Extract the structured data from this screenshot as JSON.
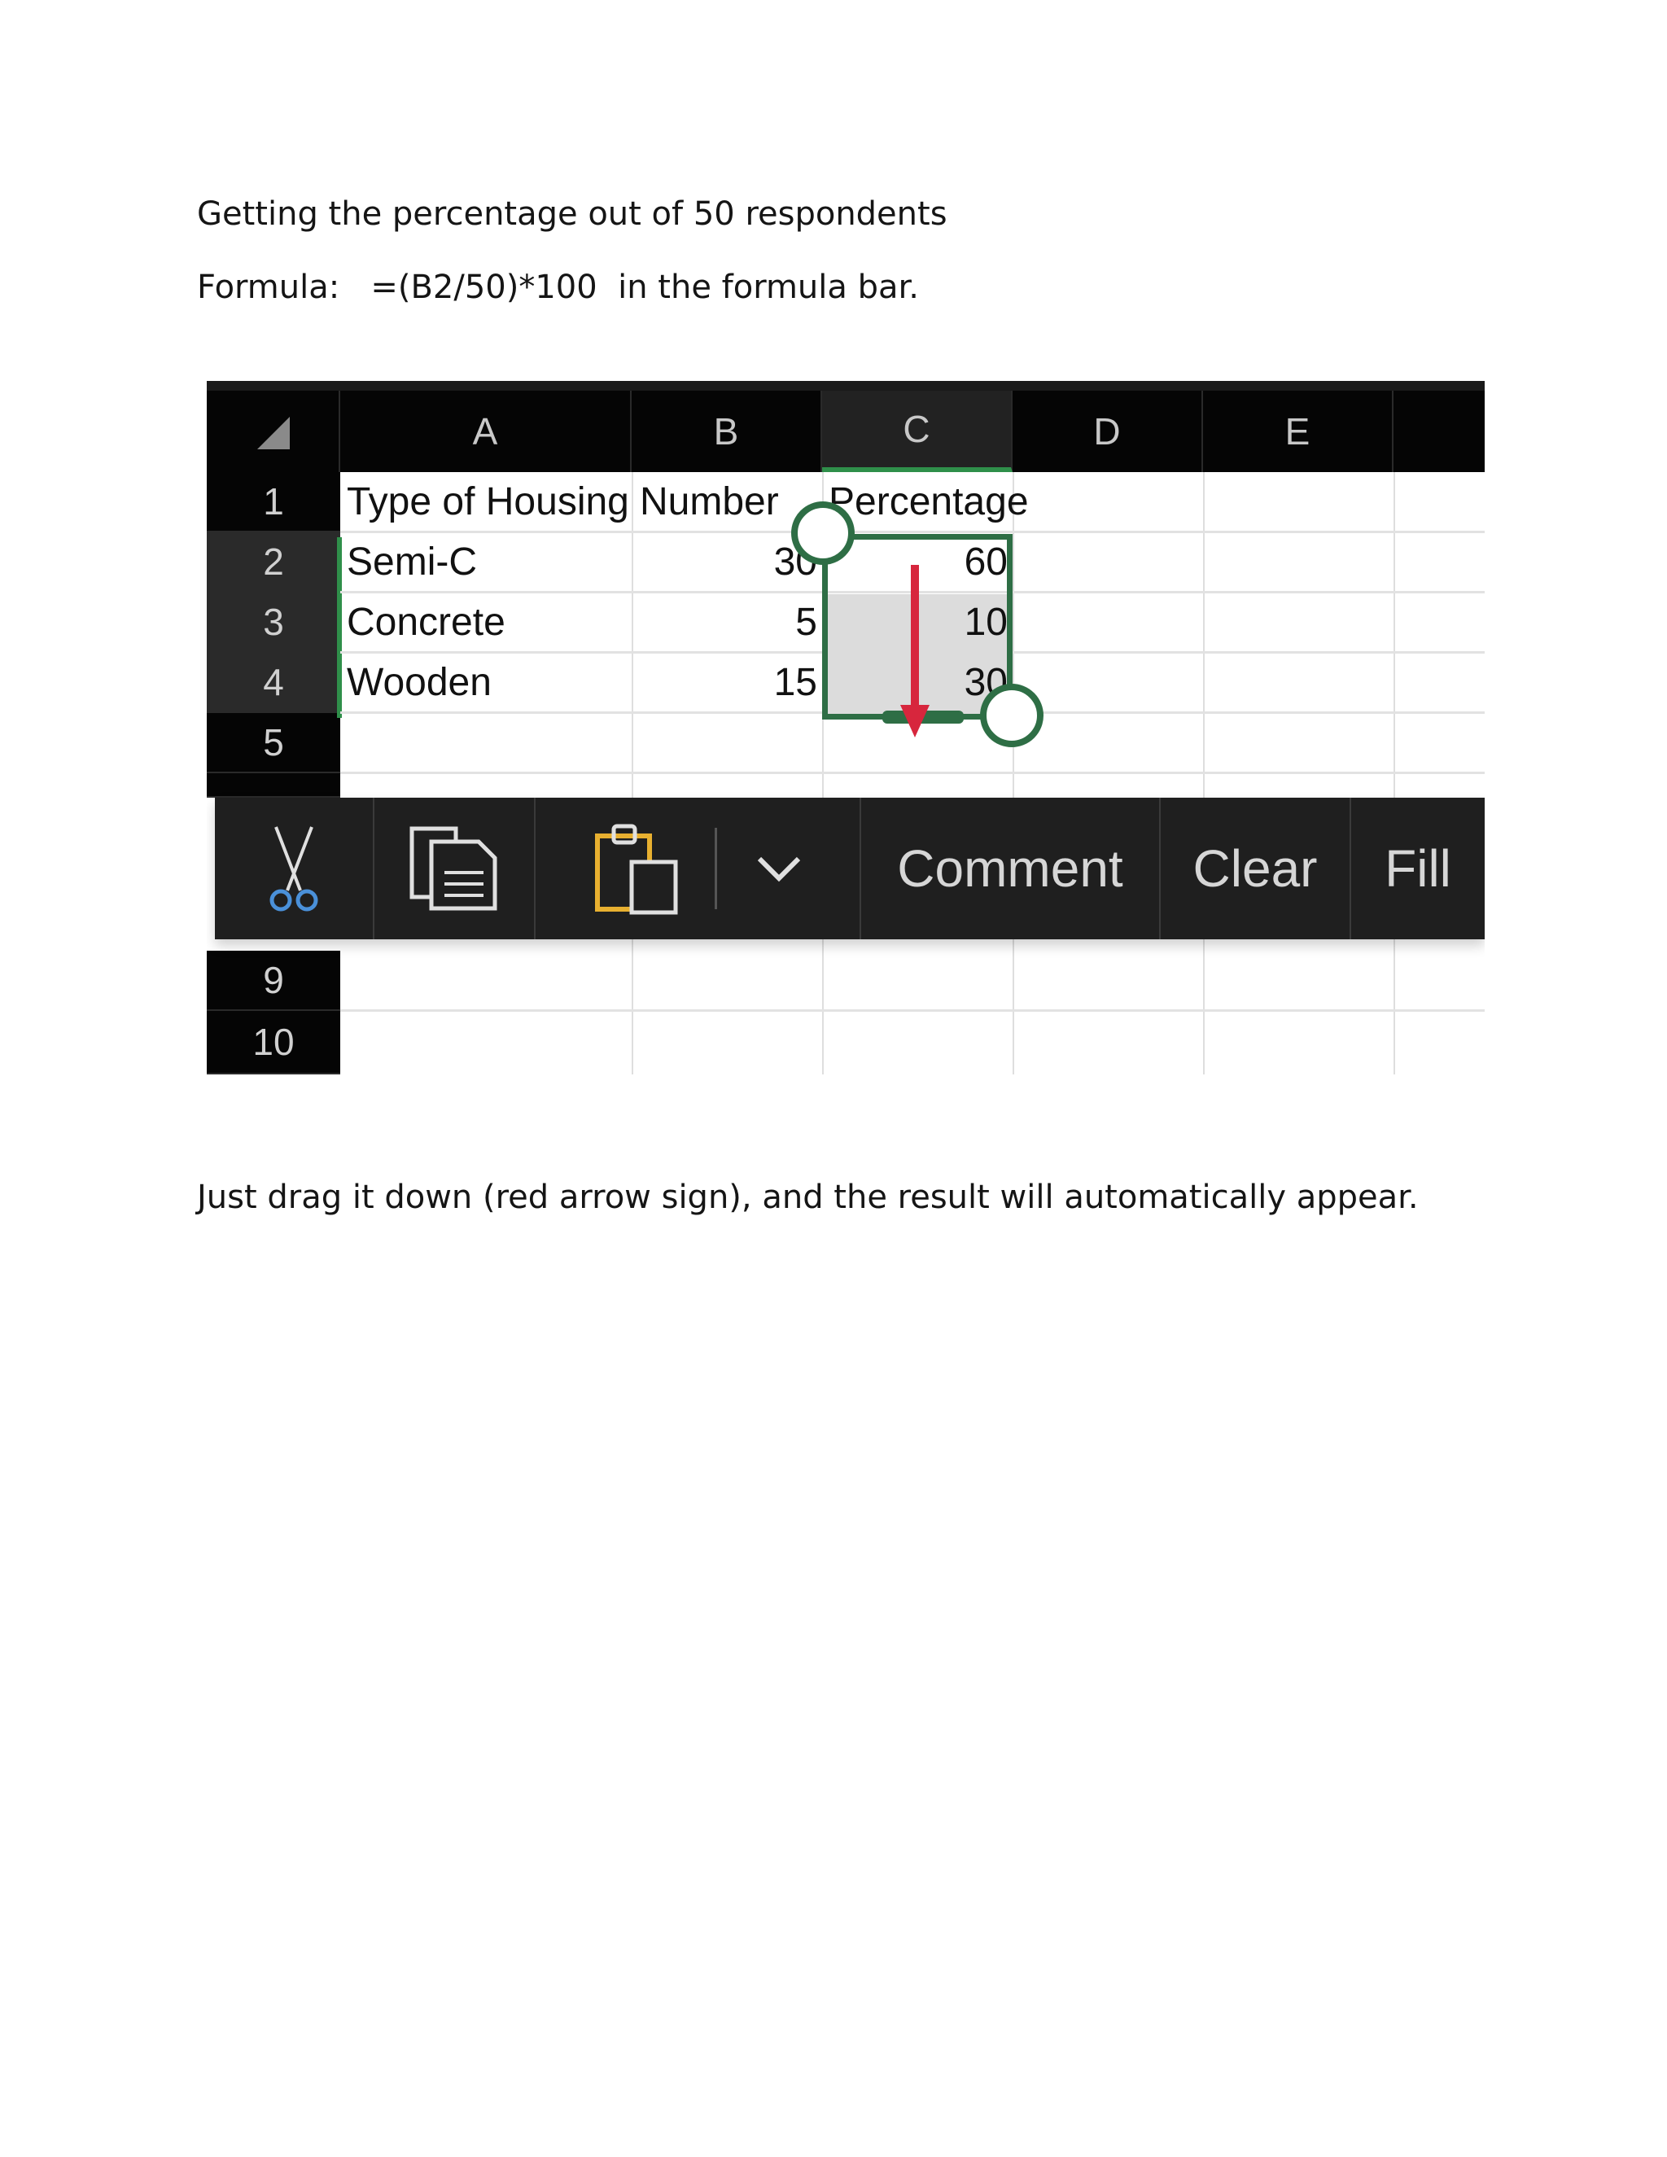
{
  "document": {
    "line1": "Getting the percentage out of 50 respondents",
    "line2": "Formula:   =(B2/50)*100  in the formula bar.",
    "line3": "Just drag it down (red arrow sign), and the result will automatically appear."
  },
  "spreadsheet": {
    "column_headers": [
      "A",
      "B",
      "C",
      "D",
      "E"
    ],
    "row_headers": [
      "1",
      "2",
      "3",
      "4",
      "5",
      "9",
      "10"
    ],
    "cells": {
      "A1": "Type of Housing",
      "B1": "Number",
      "C1": "Percentage",
      "A2": "Semi-C",
      "B2": "30",
      "C2": "60",
      "A3": "Concrete",
      "B3": "5",
      "C3": "10",
      "A4": "Wooden",
      "B4": "15",
      "C4": "30"
    },
    "selection_color": "#2e6e45",
    "arrow_color": "#d7263d"
  },
  "toolbar": {
    "cut_icon": "scissors-icon",
    "copy_icon": "copy-icon",
    "paste_icon": "paste-icon",
    "more_icon": "chevron-down-icon",
    "comment_label": "Comment",
    "clear_label": "Clear",
    "fill_label": "Fill"
  }
}
